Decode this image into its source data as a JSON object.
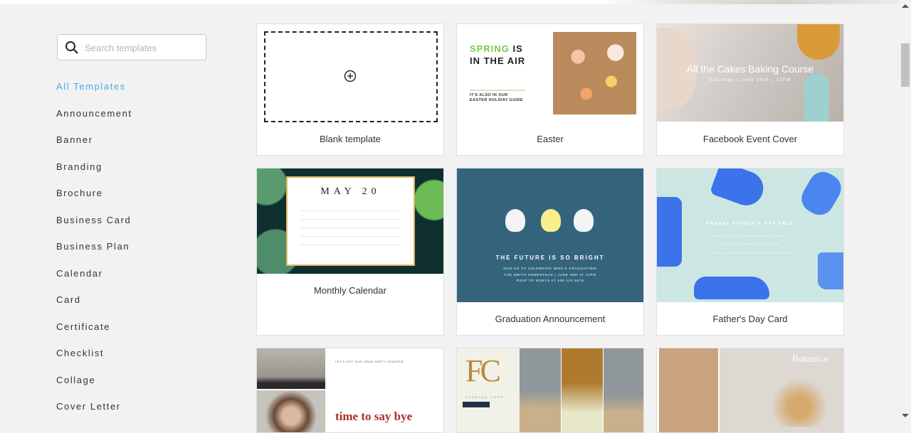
{
  "search": {
    "placeholder": "Search templates",
    "icon": "search-icon"
  },
  "sidebar": {
    "items": [
      {
        "label": "All Templates",
        "active": true
      },
      {
        "label": "Announcement"
      },
      {
        "label": "Banner"
      },
      {
        "label": "Branding"
      },
      {
        "label": "Brochure"
      },
      {
        "label": "Business Card"
      },
      {
        "label": "Business Plan"
      },
      {
        "label": "Calendar"
      },
      {
        "label": "Card"
      },
      {
        "label": "Certificate"
      },
      {
        "label": "Checklist"
      },
      {
        "label": "Collage"
      },
      {
        "label": "Cover Letter"
      }
    ]
  },
  "accent": "#4aa8e8",
  "templates": [
    {
      "label": "Blank template",
      "icon": "plus-circle-icon"
    },
    {
      "label": "Easter",
      "thumb": {
        "title_green": "SPRING",
        "title_rest1": "IS",
        "title_rest2": "IN THE AIR",
        "sub1": "IT'S ALSO IN OUR",
        "sub2": "EASTER HOLIDAY GUIDE"
      }
    },
    {
      "label": "Facebook Event Cover",
      "thumb": {
        "title": "All the Cakes Baking Course",
        "sub": "Saturday | June 15th | 12PM"
      }
    },
    {
      "label": "Monthly Calendar",
      "thumb": {
        "title": "MAY 20"
      }
    },
    {
      "label": "Graduation Announcement",
      "thumb": {
        "title": "THE FUTURE IS SO BRIGHT",
        "line1": "JOIN US TO CELEBRATE MIKE'S GRADUATION!",
        "line2": "THE SMITH HOMESTEAD | JUNE 3RD AT 12PM",
        "line3": "RSVP TO ROBYN AT 505.124.5678"
      }
    },
    {
      "label": "Father's Day Card",
      "thumb": {
        "title": "ANNUAL FATHER'S DAY SALE",
        "line1": "JOIN US FOR OUR ANNUAL FATHER'S",
        "line2": "DAY SALE! SAVE UP TO 40%",
        "line3": "ON ALL CLOTHING AND ACCESSORIES!"
      }
    },
    {
      "thumb": {
        "small": "LET'S GET THIS GRAD PARTY STARTED",
        "title": "time to say bye"
      }
    },
    {
      "thumb": {
        "mono": "FC",
        "sub": "FASHION CORE"
      }
    },
    {
      "thumb": {
        "title": "Botanica"
      }
    }
  ]
}
